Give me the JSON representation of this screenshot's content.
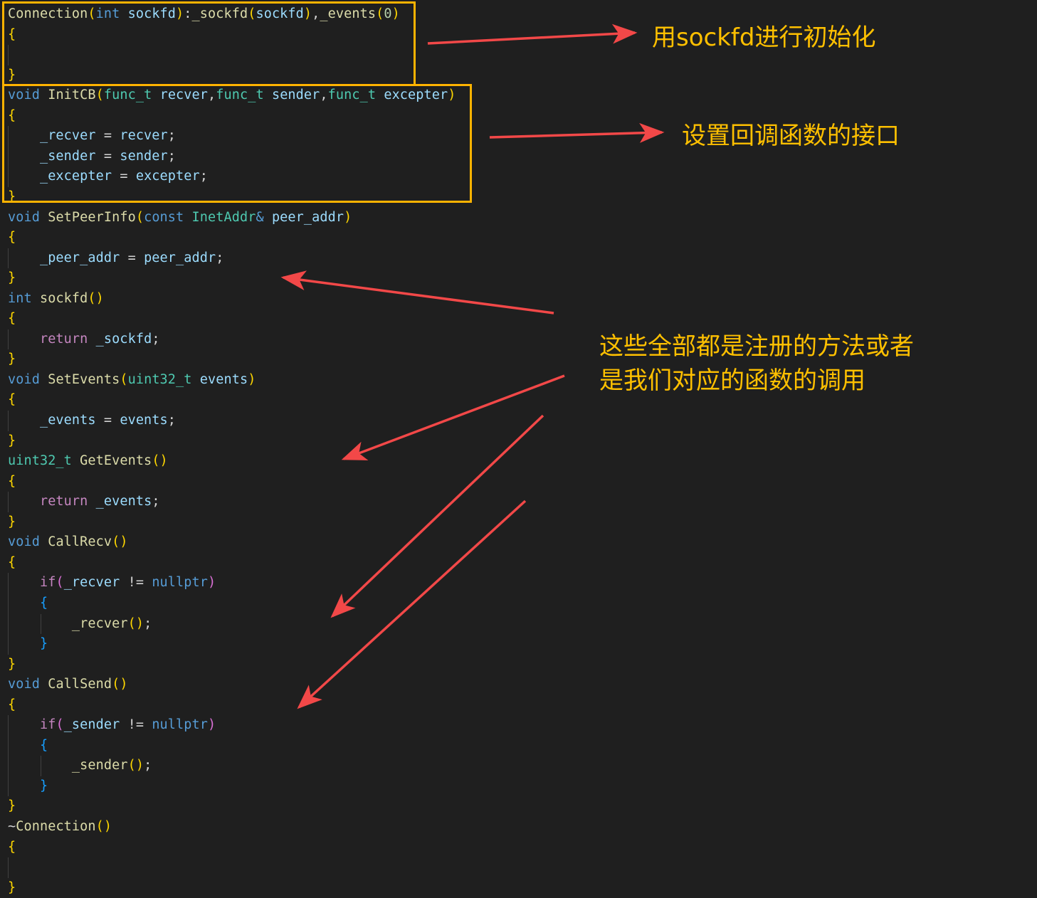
{
  "code_lines": [
    [
      [
        "fn",
        "Connection"
      ],
      [
        "p1",
        "("
      ],
      [
        "kw",
        "int"
      ],
      [
        "pl",
        " "
      ],
      [
        "var",
        "sockfd"
      ],
      [
        "p1",
        ")"
      ],
      [
        "pl",
        ":"
      ],
      [
        "fn",
        "_sockfd"
      ],
      [
        "p1",
        "("
      ],
      [
        "var",
        "sockfd"
      ],
      [
        "p1",
        ")"
      ],
      [
        "pl",
        ","
      ],
      [
        "fn",
        "_events"
      ],
      [
        "p1",
        "("
      ],
      [
        "num",
        "0"
      ],
      [
        "p1",
        ")"
      ]
    ],
    [
      [
        "p1",
        "{"
      ]
    ],
    [],
    [
      [
        "p1",
        "}"
      ]
    ],
    [
      [
        "kw",
        "void"
      ],
      [
        "pl",
        " "
      ],
      [
        "fn",
        "InitCB"
      ],
      [
        "p1",
        "("
      ],
      [
        "ty",
        "func_t"
      ],
      [
        "pl",
        " "
      ],
      [
        "var",
        "recver"
      ],
      [
        "pl",
        ","
      ],
      [
        "ty",
        "func_t"
      ],
      [
        "pl",
        " "
      ],
      [
        "var",
        "sender"
      ],
      [
        "pl",
        ","
      ],
      [
        "ty",
        "func_t"
      ],
      [
        "pl",
        " "
      ],
      [
        "var",
        "excepter"
      ],
      [
        "p1",
        ")"
      ]
    ],
    [
      [
        "p1",
        "{"
      ]
    ],
    [
      [
        "pl",
        "    "
      ],
      [
        "var",
        "_recver"
      ],
      [
        "pl",
        " = "
      ],
      [
        "var",
        "recver"
      ],
      [
        "pl",
        ";"
      ]
    ],
    [
      [
        "pl",
        "    "
      ],
      [
        "var",
        "_sender"
      ],
      [
        "pl",
        " = "
      ],
      [
        "var",
        "sender"
      ],
      [
        "pl",
        ";"
      ]
    ],
    [
      [
        "pl",
        "    "
      ],
      [
        "var",
        "_excepter"
      ],
      [
        "pl",
        " = "
      ],
      [
        "var",
        "excepter"
      ],
      [
        "pl",
        ";"
      ]
    ],
    [
      [
        "p1",
        "}"
      ]
    ],
    [
      [
        "kw",
        "void"
      ],
      [
        "pl",
        " "
      ],
      [
        "fn",
        "SetPeerInfo"
      ],
      [
        "p1",
        "("
      ],
      [
        "kw",
        "const"
      ],
      [
        "pl",
        " "
      ],
      [
        "ty",
        "InetAddr"
      ],
      [
        "kw",
        "&"
      ],
      [
        "pl",
        " "
      ],
      [
        "var",
        "peer_addr"
      ],
      [
        "p1",
        ")"
      ]
    ],
    [
      [
        "p1",
        "{"
      ]
    ],
    [
      [
        "pl",
        "    "
      ],
      [
        "var",
        "_peer_addr"
      ],
      [
        "pl",
        " = "
      ],
      [
        "var",
        "peer_addr"
      ],
      [
        "pl",
        ";"
      ]
    ],
    [
      [
        "p1",
        "}"
      ]
    ],
    [
      [
        "kw",
        "int"
      ],
      [
        "pl",
        " "
      ],
      [
        "fn",
        "sockfd"
      ],
      [
        "p1",
        "()"
      ]
    ],
    [
      [
        "p1",
        "{"
      ]
    ],
    [
      [
        "pl",
        "    "
      ],
      [
        "ctl",
        "return"
      ],
      [
        "pl",
        " "
      ],
      [
        "var",
        "_sockfd"
      ],
      [
        "pl",
        ";"
      ]
    ],
    [
      [
        "p1",
        "}"
      ]
    ],
    [
      [
        "kw",
        "void"
      ],
      [
        "pl",
        " "
      ],
      [
        "fn",
        "SetEvents"
      ],
      [
        "p1",
        "("
      ],
      [
        "ty",
        "uint32_t"
      ],
      [
        "pl",
        " "
      ],
      [
        "var",
        "events"
      ],
      [
        "p1",
        ")"
      ]
    ],
    [
      [
        "p1",
        "{"
      ]
    ],
    [
      [
        "pl",
        "    "
      ],
      [
        "var",
        "_events"
      ],
      [
        "pl",
        " = "
      ],
      [
        "var",
        "events"
      ],
      [
        "pl",
        ";"
      ]
    ],
    [
      [
        "p1",
        "}"
      ]
    ],
    [
      [
        "ty",
        "uint32_t"
      ],
      [
        "pl",
        " "
      ],
      [
        "fn",
        "GetEvents"
      ],
      [
        "p1",
        "()"
      ]
    ],
    [
      [
        "p1",
        "{"
      ]
    ],
    [
      [
        "pl",
        "    "
      ],
      [
        "ctl",
        "return"
      ],
      [
        "pl",
        " "
      ],
      [
        "var",
        "_events"
      ],
      [
        "pl",
        ";"
      ]
    ],
    [
      [
        "p1",
        "}"
      ]
    ],
    [
      [
        "kw",
        "void"
      ],
      [
        "pl",
        " "
      ],
      [
        "fn",
        "CallRecv"
      ],
      [
        "p1",
        "()"
      ]
    ],
    [
      [
        "p1",
        "{"
      ]
    ],
    [
      [
        "pl",
        "    "
      ],
      [
        "ctl",
        "if"
      ],
      [
        "p2",
        "("
      ],
      [
        "var",
        "_recver"
      ],
      [
        "pl",
        " != "
      ],
      [
        "kw",
        "nullptr"
      ],
      [
        "p2",
        ")"
      ]
    ],
    [
      [
        "pl",
        "    "
      ],
      [
        "p3",
        "{"
      ]
    ],
    [
      [
        "pl",
        "        "
      ],
      [
        "fn",
        "_recver"
      ],
      [
        "p1",
        "()"
      ],
      [
        "pl",
        ";"
      ]
    ],
    [
      [
        "pl",
        "    "
      ],
      [
        "p3",
        "}"
      ]
    ],
    [
      [
        "p1",
        "}"
      ]
    ],
    [
      [
        "kw",
        "void"
      ],
      [
        "pl",
        " "
      ],
      [
        "fn",
        "CallSend"
      ],
      [
        "p1",
        "()"
      ]
    ],
    [
      [
        "p1",
        "{"
      ]
    ],
    [
      [
        "pl",
        "    "
      ],
      [
        "ctl",
        "if"
      ],
      [
        "p2",
        "("
      ],
      [
        "var",
        "_sender"
      ],
      [
        "pl",
        " != "
      ],
      [
        "kw",
        "nullptr"
      ],
      [
        "p2",
        ")"
      ]
    ],
    [
      [
        "pl",
        "    "
      ],
      [
        "p3",
        "{"
      ]
    ],
    [
      [
        "pl",
        "        "
      ],
      [
        "fn",
        "_sender"
      ],
      [
        "p1",
        "()"
      ],
      [
        "pl",
        ";"
      ]
    ],
    [
      [
        "pl",
        "    "
      ],
      [
        "p3",
        "}"
      ]
    ],
    [
      [
        "p1",
        "}"
      ]
    ],
    [
      [
        "pl",
        "~"
      ],
      [
        "fn",
        "Connection"
      ],
      [
        "p1",
        "()"
      ]
    ],
    [
      [
        "p1",
        "{"
      ]
    ],
    [],
    [
      [
        "p1",
        "}"
      ]
    ]
  ],
  "annotations": {
    "init": "用sockfd进行初始化",
    "callbacks": "设置回调函数的接口",
    "methods_line1": "这些全部都是注册的方法或者",
    "methods_line2": "是我们对应的函数的调用"
  },
  "colors": {
    "background": "#1f1f1f",
    "highlight_box": "#ffb300",
    "arrow": "#f24848",
    "annotation_text": "#ffc000"
  }
}
